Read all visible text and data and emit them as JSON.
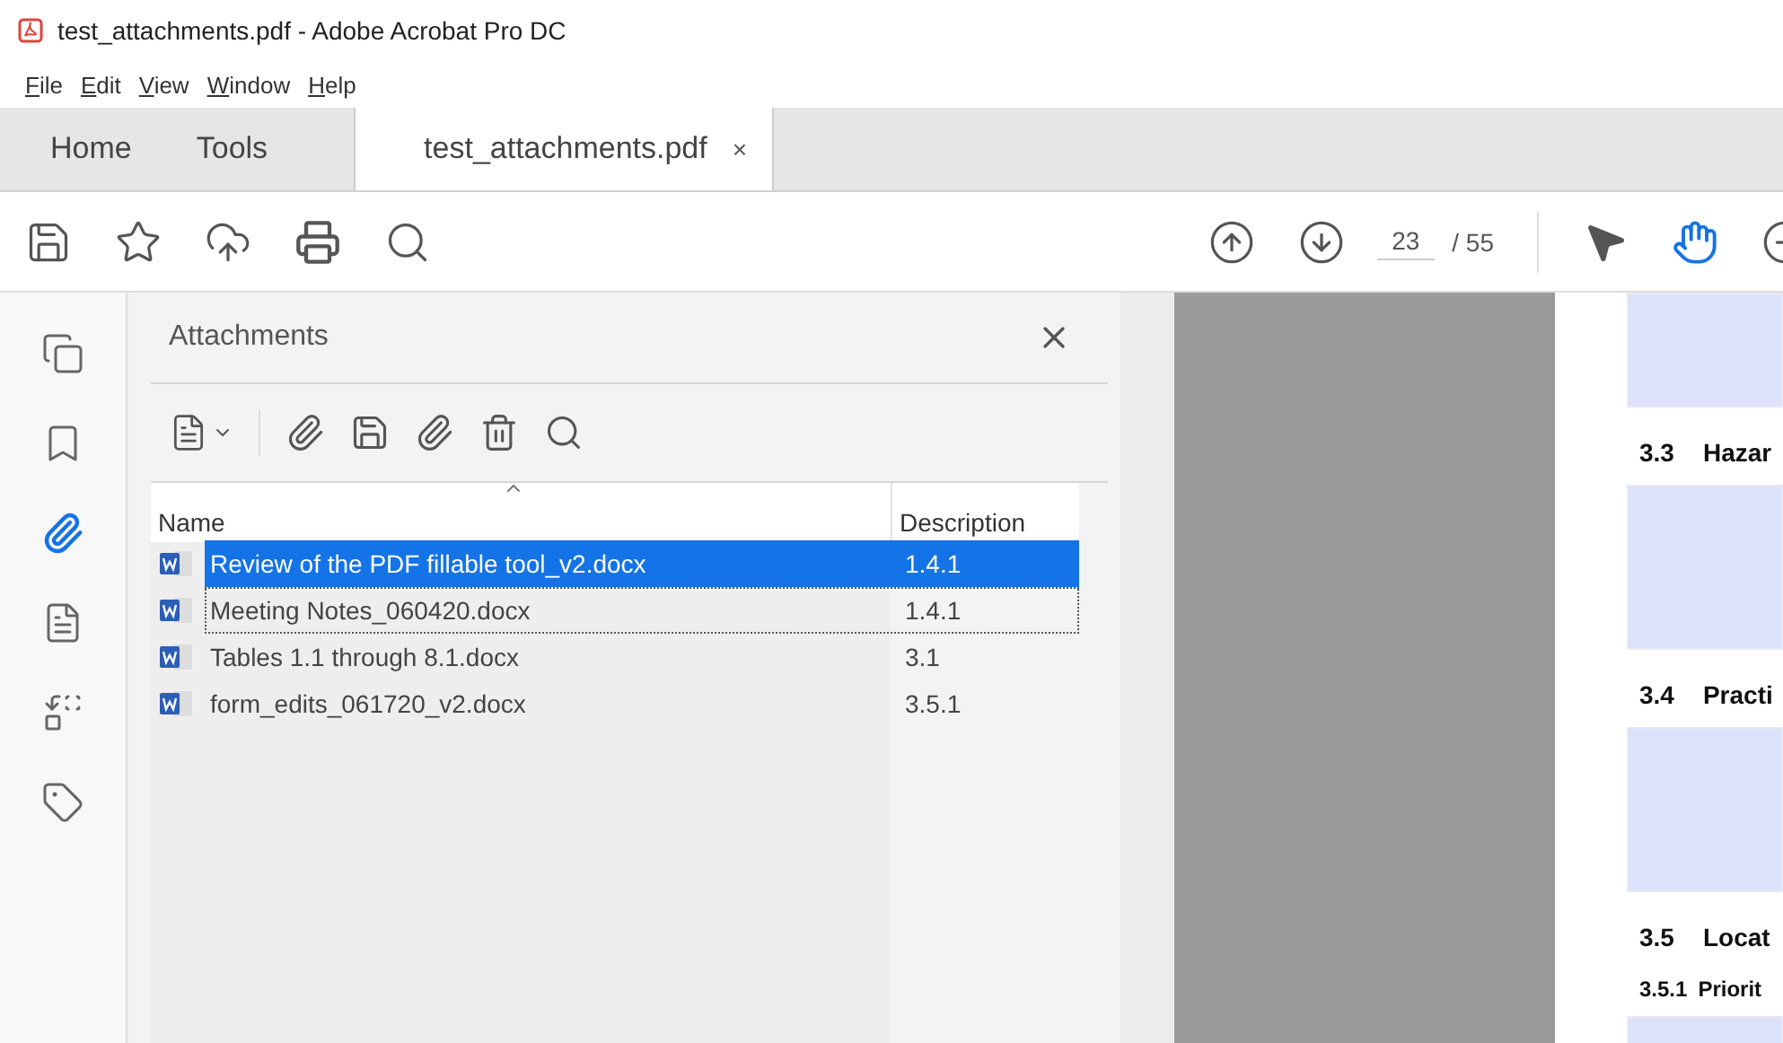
{
  "window": {
    "title": "test_attachments.pdf - Adobe Acrobat Pro DC"
  },
  "menu": [
    "File",
    "Edit",
    "View",
    "Window",
    "Help"
  ],
  "tabs": [
    {
      "label": "Home",
      "selected": false
    },
    {
      "label": "Tools",
      "selected": false
    },
    {
      "label": "test_attachments.pdf",
      "selected": true,
      "close": "×"
    }
  ],
  "toolbar": {
    "page_current": "23",
    "page_separator": "/ 55",
    "tools": [
      {
        "kind": "select",
        "selected": false
      },
      {
        "kind": "hand",
        "selected": true
      }
    ]
  },
  "rail": [
    {
      "kind": "pages",
      "selected": false
    },
    {
      "kind": "bookmarks",
      "selected": false
    },
    {
      "kind": "attachments",
      "selected": true
    },
    {
      "kind": "document",
      "selected": false
    },
    {
      "kind": "compare",
      "selected": false
    },
    {
      "kind": "tags",
      "selected": false
    }
  ],
  "attachments": {
    "title": "Attachments",
    "columns": [
      "Name",
      "Description"
    ],
    "rows": [
      {
        "name": "Review of the PDF fillable tool_v2.docx",
        "description": "1.4.1",
        "selected": true,
        "focused": false
      },
      {
        "name": "Meeting Notes_060420.docx",
        "description": "1.4.1",
        "selected": false,
        "focused": true
      },
      {
        "name": "Tables 1.1 through 8.1.docx",
        "description": "3.1",
        "selected": false,
        "focused": false
      },
      {
        "name": "form_edits_061720_v2.docx",
        "description": "3.5.1",
        "selected": false,
        "focused": false
      }
    ]
  },
  "document": [
    {
      "kind": "short_field"
    },
    {
      "kind": "heading",
      "number": "3.3",
      "text": "Hazar"
    },
    {
      "kind": "tall_field"
    },
    {
      "kind": "heading",
      "number": "3.4",
      "text": "Practi"
    },
    {
      "kind": "tall_field"
    },
    {
      "kind": "heading",
      "number": "3.5",
      "text": "Locat"
    },
    {
      "kind": "subheading",
      "number": "3.5.1",
      "text": "Priorit"
    },
    {
      "kind": "short_field"
    }
  ]
}
